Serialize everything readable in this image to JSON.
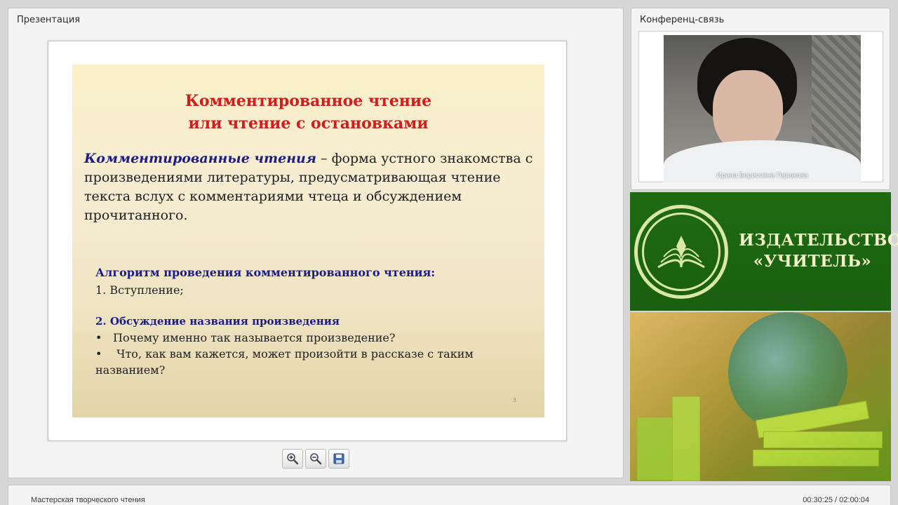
{
  "presentation": {
    "title": "Презентация",
    "slide": {
      "title_line1": "Комментированное чтение",
      "title_line2": "или чтение с остановками",
      "definition_term": "Комментированные чтения",
      "definition_text": " – форма устного знакомства с произведениями литературы, предусматривающая чтение текста вслух с комментариями чтеца и обсуждением прочитанного.",
      "algorithm_title": "Алгоритм проведения комментированного чтения:",
      "step1": "1. Вступление;",
      "step2": "2. Обсуждение названия произведения",
      "bullet_marker": "•",
      "bullets": [
        "Почему именно так называется произведение?",
        " Что, как вам кажется, может произойти в рассказе с таким названием?"
      ],
      "page_number": "3"
    },
    "toolbar": {
      "zoom_in_icon": "zoom-in-icon",
      "zoom_out_icon": "zoom-out-icon",
      "save_icon": "save-icon"
    }
  },
  "conference": {
    "title": "Конференц-связь",
    "speaker_name": "Ирина Борисовна Горшкова"
  },
  "banner": {
    "line1": "ИЗДАТЕЛЬСТВО",
    "line2": "«УЧИТЕЛЬ»"
  },
  "footer": {
    "course_title": "Мастерская творческого чтения",
    "time": "00:30:25 / 02:00:04"
  },
  "colors": {
    "slide_title": "#d41c1c",
    "slide_accent": "#1b1b8a",
    "banner_green": "#1f6a12",
    "banner_text": "#f2f3c8"
  }
}
